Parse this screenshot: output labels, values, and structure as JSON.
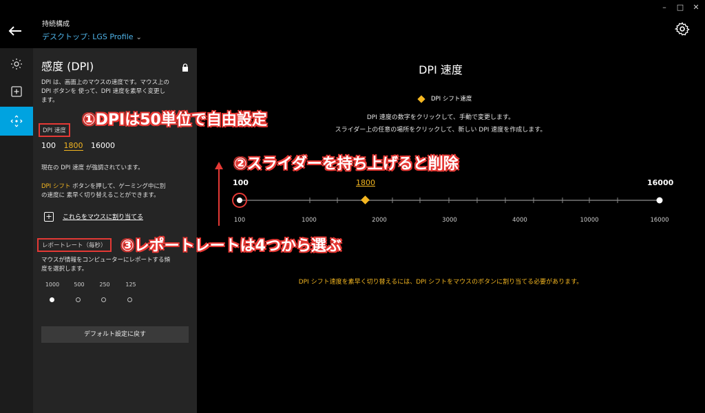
{
  "window": {
    "minimize": "–",
    "maximize": "□",
    "close": "✕"
  },
  "header": {
    "subtitle": "持続構成",
    "title": "デスクトップ: LGS Profile"
  },
  "panel": {
    "title": "感度 (DPI)",
    "description": [
      "DPI は、画面上のマウスの速度です。マウス上の",
      "DPI ボタンを 使って、DPI 速度を素早く変更し",
      "ます。"
    ],
    "dpi_speed_label": "DPI 速度",
    "dpi_values": [
      "100",
      "1800",
      "16000"
    ],
    "selected_dpi": "1800",
    "highlight_note": "現在の DPI 速度 が強調されています。",
    "shift_line1_prefix": "DPI シフト",
    "shift_line1_rest": " ボタンを押して、ゲーミング中に別",
    "shift_line2": "の速度に 素早く切り替えることができます。",
    "assign_link": "これらをマウスに割り当てる",
    "report_rate_label": "レポートレート（毎秒）",
    "report_rate_desc": [
      "マウスが情報をコンピューターにレポートする頻",
      "度を選択します。"
    ],
    "report_rates": [
      "1000",
      "500",
      "250",
      "125"
    ],
    "selected_rate": "1000",
    "reset_button": "デフォルト設定に戻す"
  },
  "main": {
    "title": "DPI 速度",
    "shift_legend": "DPI シフト速度",
    "instruction1": "DPI 速度の数字をクリックして、手動で変更します。",
    "instruction2": "スライダー上の任意の場所をクリックして、新しい DPI 速度を作成します。",
    "slider": {
      "min": 100,
      "max": 16000,
      "min_label": "100",
      "max_label": "16000",
      "points": [
        100,
        16000
      ],
      "shift_value": 1800,
      "shift_label": "1800",
      "ticks": [
        "100",
        "1000",
        "2000",
        "3000",
        "4000",
        "10000",
        "16000"
      ]
    },
    "warning": "DPI シフト速度を素早く切り替えるには、DPI シフトをマウスのボタンに割り当てる必要があります。"
  },
  "annotations": {
    "a1": "①DPIは50単位で自由設定",
    "a2": "②スライダーを持ち上げると削除",
    "a3": "③レポートレートは4つから選ぶ"
  },
  "colors": {
    "accent": "#00a3e0",
    "shift": "#f5b721",
    "annotation": "#e53935"
  }
}
